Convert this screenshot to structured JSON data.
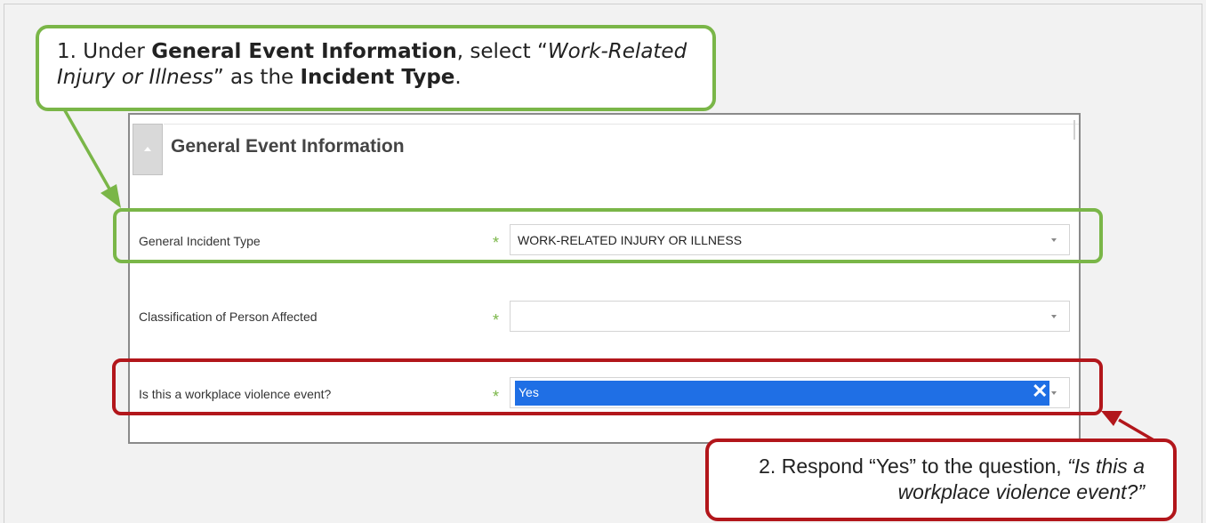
{
  "panel": {
    "title": "General Event Information",
    "fields": [
      {
        "label": "General Incident Type",
        "value": "WORK-RELATED INJURY OR ILLNESS",
        "required_mark": "*"
      },
      {
        "label": "Classification of Person Affected",
        "value": "",
        "required_mark": "*"
      },
      {
        "label": "Is this a workplace violence event?",
        "value": "Yes",
        "required_mark": "*",
        "clear_glyph": "✕"
      }
    ]
  },
  "callout1": {
    "number": "1.",
    "t1": "Under ",
    "b1": "General Event Information",
    "t2": ", select “",
    "i1": "Work-Related Injury or Illness",
    "t3": "” as the ",
    "b2": "Incident Type",
    "t4": "."
  },
  "callout2": {
    "number": "2.",
    "t1": "Respond “Yes” to the question, ",
    "i1": "“Is this a workplace violence event?”"
  },
  "colors": {
    "green": "#7ab648",
    "red": "#b2161b",
    "selection": "#1f6fe5"
  },
  "icons": {
    "collapse": "collapse-caret-icon",
    "dropdown": "chevron-down-icon",
    "clear": "close-icon"
  }
}
